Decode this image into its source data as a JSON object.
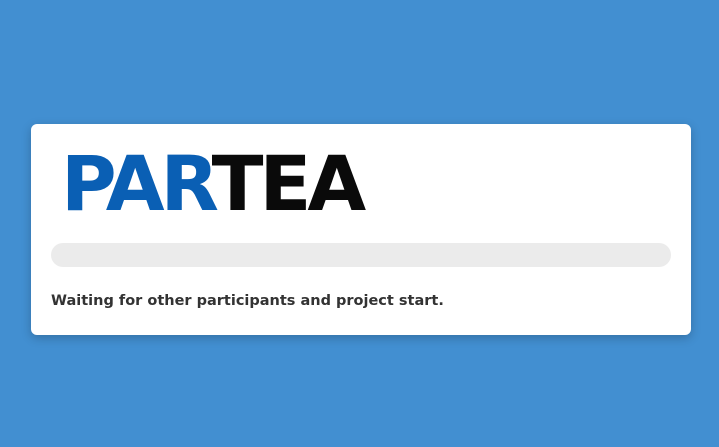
{
  "colors": {
    "page_background": "#428fd1",
    "logo_primary": "#0a5fb4",
    "logo_secondary": "#0a0a0a",
    "progress_track": "#ebebeb"
  },
  "logo": {
    "part1": "PAR",
    "part2": "TEA"
  },
  "progress": {
    "percent": 0
  },
  "status": {
    "message": "Waiting for other participants and project start."
  }
}
